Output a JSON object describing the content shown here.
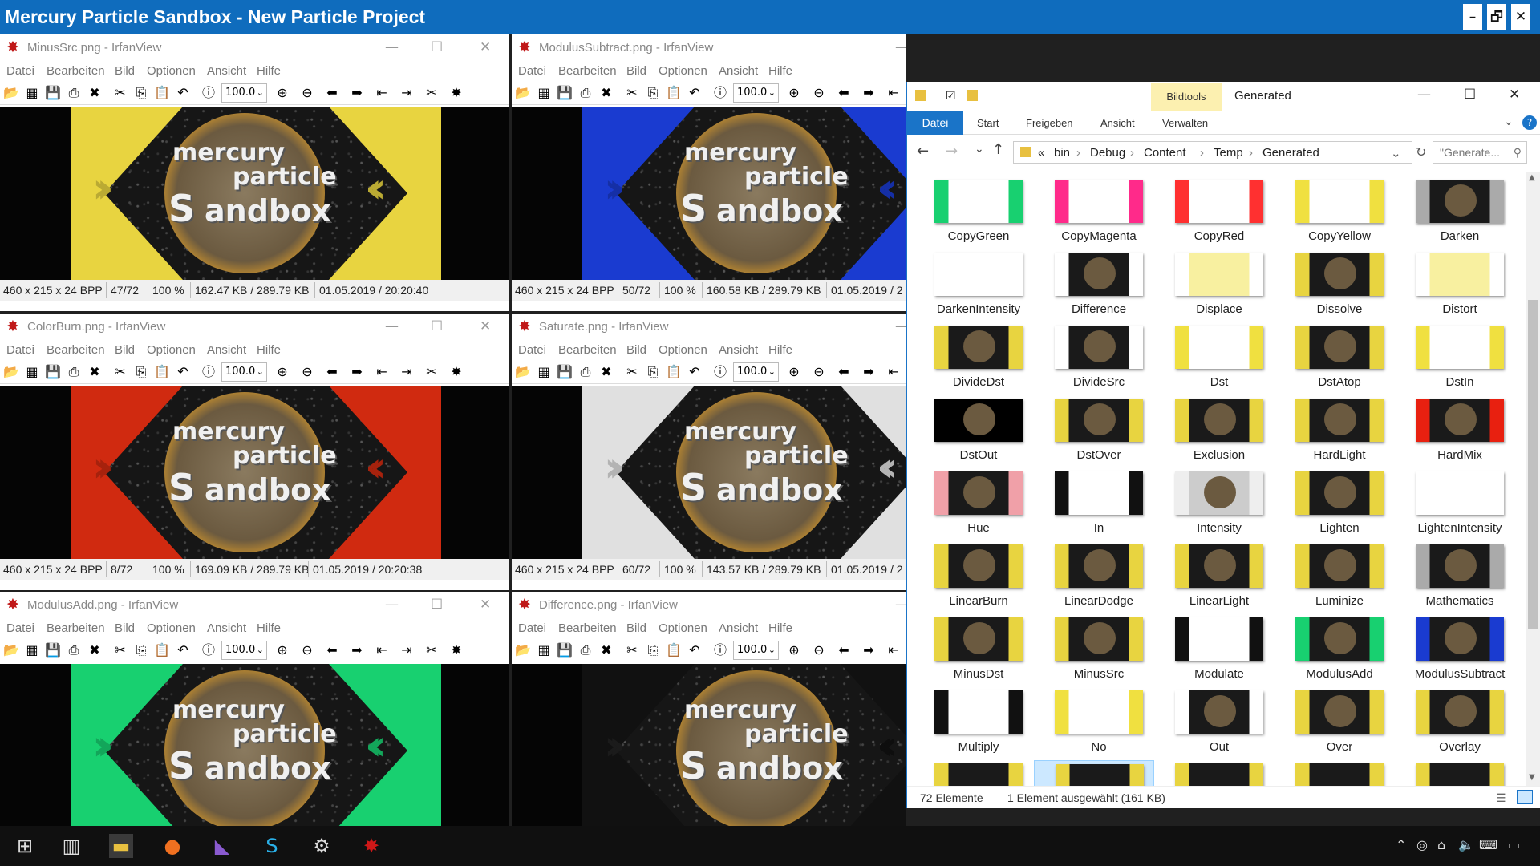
{
  "app": {
    "title": "Mercury Particle Sandbox - New Particle Project",
    "minimize": "–",
    "restore": "🗗",
    "close": "✕"
  },
  "irfan": {
    "menu": [
      "Datei",
      "Bearbeiten",
      "Bild",
      "Optionen",
      "Ansicht",
      "Hilfe"
    ],
    "zoom": "100.0",
    "watermark": {
      "line1": "mercury",
      "line2": "particle",
      "line3": "andbox"
    },
    "windows": [
      {
        "title": "MinusSrc.png - IrfanView",
        "dims": "460 x 215 x 24 BPP",
        "index": "47/72",
        "zoom": "100 %",
        "size": "162.47 KB / 289.79 KB",
        "date": "01.05.2019 / 20:20:40"
      },
      {
        "title": "ModulusSubtract.png - IrfanView",
        "dims": "460 x 215 x 24 BPP",
        "index": "50/72",
        "zoom": "100 %",
        "size": "160.58 KB / 289.79 KB",
        "date": "01.05.2019 / 2"
      },
      {
        "title": "ColorBurn.png - IrfanView",
        "dims": "460 x 215 x 24 BPP",
        "index": "8/72",
        "zoom": "100 %",
        "size": "169.09 KB / 289.79 KB",
        "date": "01.05.2019 / 20:20:38"
      },
      {
        "title": "Saturate.png - IrfanView",
        "dims": "460 x 215 x 24 BPP",
        "index": "60/72",
        "zoom": "100 %",
        "size": "143.57 KB / 289.79 KB",
        "date": "01.05.2019 / 2"
      },
      {
        "title": "ModulusAdd.png - IrfanView"
      },
      {
        "title": "Difference.png - IrfanView"
      }
    ],
    "colors": [
      "#e8d440",
      "#1a3bd0",
      "#d02a10",
      "#e0e0e0",
      "#18d070",
      "#111111"
    ]
  },
  "explorer": {
    "ribbon_context": "Bildtools",
    "title": "Generated",
    "tabs": [
      "Datei",
      "Start",
      "Freigeben",
      "Ansicht",
      "Verwalten"
    ],
    "breadcrumb": [
      "«",
      "bin",
      "Debug",
      "Content",
      "Temp",
      "Generated"
    ],
    "search_placeholder": "\"Generate...",
    "items": [
      "CopyGreen",
      "CopyMagenta",
      "CopyRed",
      "CopyYellow",
      "Darken",
      "DarkenIntensity",
      "Difference",
      "Displace",
      "Dissolve",
      "Distort",
      "DivideDst",
      "DivideSrc",
      "Dst",
      "DstAtop",
      "DstIn",
      "DstOut",
      "DstOver",
      "Exclusion",
      "HardLight",
      "HardMix",
      "Hue",
      "In",
      "Intensity",
      "Lighten",
      "LightenIntensity",
      "LinearBurn",
      "LinearDodge",
      "LinearLight",
      "Luminize",
      "Mathematics",
      "MinusDst",
      "MinusSrc",
      "Modulate",
      "ModulusAdd",
      "ModulusSubtract",
      "Multiply",
      "No",
      "Out",
      "Over",
      "Overlay"
    ],
    "thumb_styles": [
      "white-green",
      "white-magenta",
      "white-red",
      "white-yellow",
      "dark",
      "blank",
      "dark-white",
      "yellow-faded",
      "dark-yellow",
      "yellow-faded",
      "dark-yellow",
      "dark-white",
      "white-yellow",
      "dark-yellow",
      "white-yellow",
      "black",
      "dark-yellow",
      "dark-yellow",
      "dark-yellow",
      "dark-red",
      "dark-pink",
      "white-black",
      "gray",
      "dark-yellow",
      "blank",
      "dark-yellow",
      "dark-yellow",
      "dark-yellow",
      "dark-yellow",
      "dark",
      "dark-yellow",
      "dark-yellow",
      "white-black",
      "dark-green",
      "dark-blue",
      "white-black",
      "white-yellow",
      "dark-white",
      "dark-yellow",
      "dark-yellow"
    ],
    "status_count": "72 Elemente",
    "status_selected": "1 Element ausgewählt (161 KB)"
  }
}
